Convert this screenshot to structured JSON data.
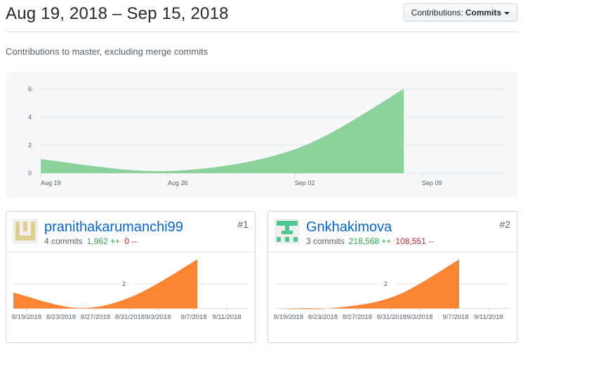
{
  "header": {
    "date_range": "Aug 19, 2018 – Sep 15, 2018",
    "filter_label": "Contributions:",
    "filter_value": "Commits"
  },
  "subtitle": "Contributions to master, excluding merge commits",
  "colors": {
    "commits_green": "#8cd29c",
    "contributor_orange": "#fb8532",
    "link_blue": "#0366d6",
    "additions_green": "#28a745",
    "deletions_red": "#cb2431"
  },
  "chart_data": [
    {
      "type": "area",
      "x": [
        "Aug 19",
        "Aug 26",
        "Sep 02",
        "Sep 09"
      ],
      "y_ticks": [
        "0",
        "2",
        "4",
        "6"
      ],
      "ylim": [
        0,
        6.2
      ],
      "series": [
        {
          "color": "#8cd29c",
          "points": [
            [
              0,
              1
            ],
            [
              7,
              0.15
            ],
            [
              14,
              1.7
            ],
            [
              20,
              6
            ]
          ]
        }
      ],
      "grid": true
    },
    {
      "type": "area",
      "contributor": "pranithakarumanchi99",
      "x": [
        "8/19/2018",
        "8/23/2018",
        "8/27/2018",
        "8/31/2018",
        "9/3/2018",
        "9/7/2018",
        "9/11/2018"
      ],
      "y_ticks": [
        "2"
      ],
      "ylim": [
        0,
        4
      ],
      "series": [
        {
          "color": "#fb8532",
          "points": [
            [
              0,
              1.3
            ],
            [
              7,
              0.05
            ],
            [
              13,
              1.0
            ],
            [
              20,
              4
            ]
          ]
        }
      ]
    },
    {
      "type": "area",
      "contributor": "Gnkhakimova",
      "x": [
        "8/19/2018",
        "8/23/2018",
        "8/27/2018",
        "8/31/2018",
        "9/3/2018",
        "9/7/2018",
        "9/11/2018"
      ],
      "y_ticks": [
        "2"
      ],
      "ylim": [
        0,
        4
      ],
      "series": [
        {
          "color": "#fb8532",
          "points": [
            [
              0,
              0
            ],
            [
              6,
              0.02
            ],
            [
              13,
              1.0
            ],
            [
              20,
              4
            ]
          ]
        }
      ]
    }
  ],
  "contributors": [
    {
      "name": "pranithakarumanchi99",
      "rank": "#1",
      "commits": "4 commits",
      "additions": "1,962 ++",
      "deletions": "0 --",
      "avatar_color": "#e0cf8f"
    },
    {
      "name": "Gnkhakimova",
      "rank": "#2",
      "commits": "3 commits",
      "additions": "218,568 ++",
      "deletions": "108,551 --",
      "avatar_color": "#4ec792"
    }
  ]
}
